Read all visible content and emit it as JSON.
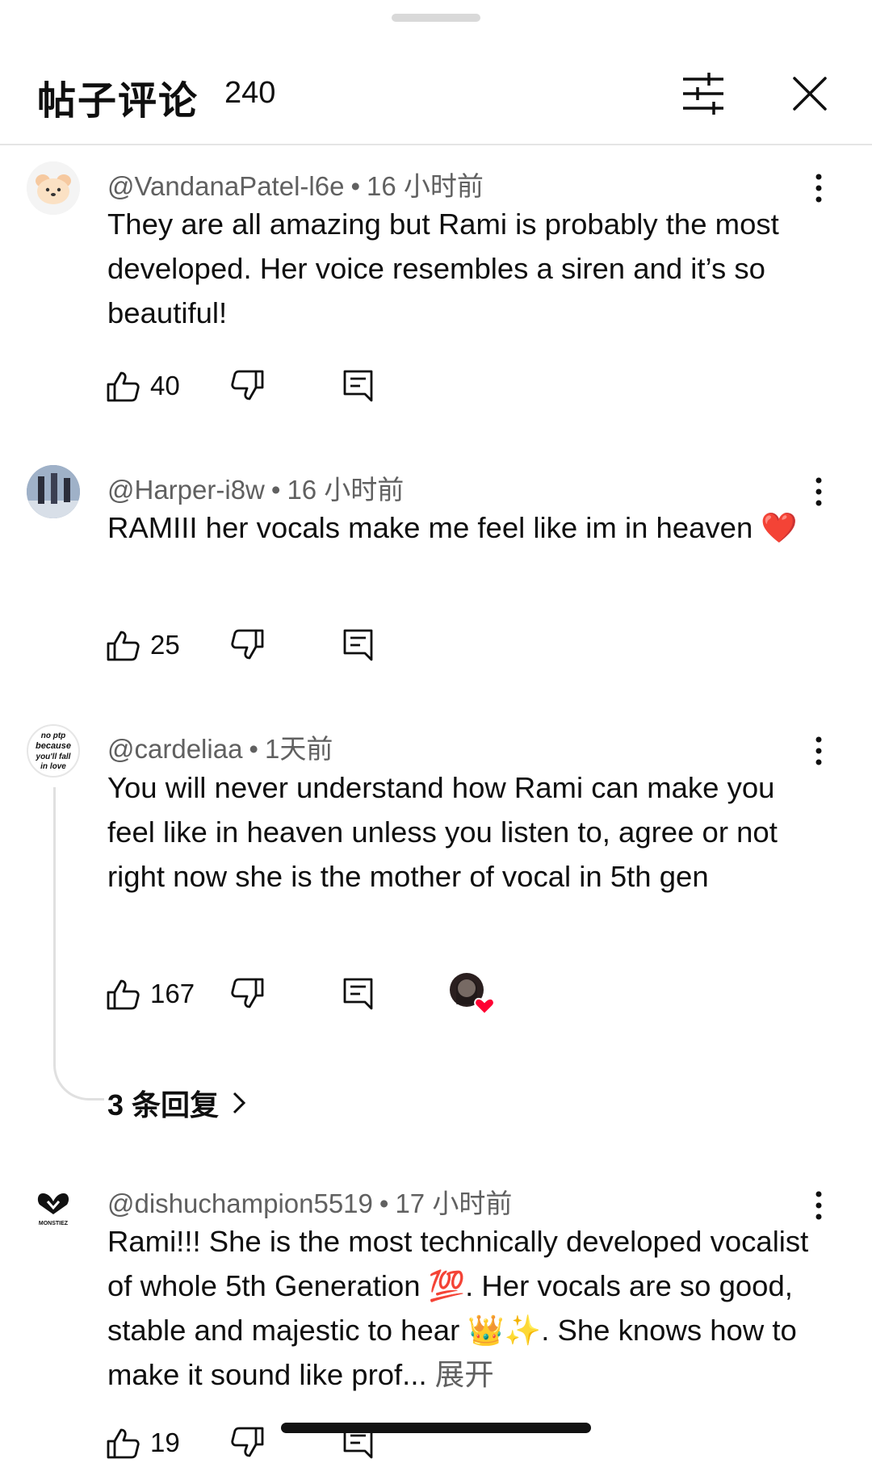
{
  "header": {
    "title": "帖子评论",
    "count": "240"
  },
  "comments": [
    {
      "author": "@VandanaPatel-l6e",
      "time": "16 小时前",
      "text": "They are all amazing but Rami is probably the most developed. Her voice resembles a siren and it’s so beautiful!",
      "likes": "40"
    },
    {
      "author": "@Harper-i8w",
      "time": "16 小时前",
      "text": "RAMIII her vocals make me feel like im in heaven ❤️",
      "likes": "25"
    },
    {
      "author": "@cardeliaa",
      "time": "1天前",
      "text": "You will never understand how Rami can make you feel like in heaven unless you listen to, agree or not right now she is the mother of vocal in 5th gen",
      "likes": "167",
      "replies_label": "3 条回复",
      "avatar_text": [
        "no ptp",
        "because",
        "you'll fall",
        "in love"
      ]
    },
    {
      "author": "@dishuchampion5519",
      "time": "17 小时前",
      "text": "Rami!!! She is the most technically developed vocalist of whole 5th Generation 💯. Her vocals are so good, stable and majestic to hear 👑✨. She knows how to make it sound like prof...",
      "more_label": "展开",
      "likes": "19",
      "avatar_text": "MONSTIEZ"
    }
  ],
  "colors": {
    "text": "#0f0f0f",
    "secondary": "#606060",
    "divider": "#e5e5e5",
    "heart": "#ff0033"
  }
}
